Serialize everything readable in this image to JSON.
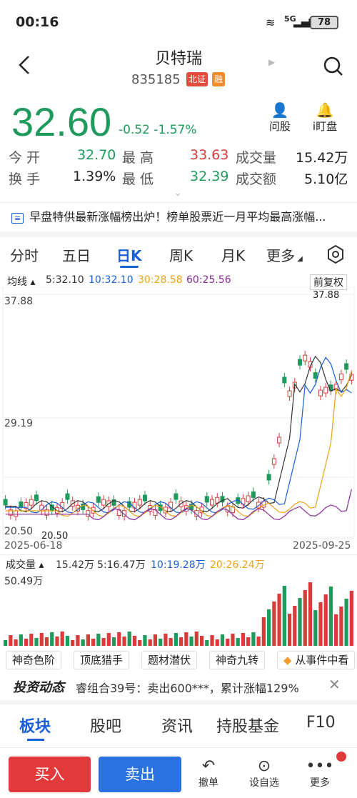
{
  "status": {
    "time": "00:16",
    "battery": "78",
    "network": "5G"
  },
  "header": {
    "title": "贝特瑞",
    "code": "835185",
    "tag_market": "北证",
    "tag_margin": "融",
    "ask_label": "问股",
    "watch_label": "i盯盘"
  },
  "quote": {
    "price": "32.60",
    "change": "-0.52",
    "change_pct": "-1.57%",
    "open_label": "今 开",
    "open": "32.70",
    "high_label": "最 高",
    "high": "33.63",
    "vol_label": "成交量",
    "vol": "15.42万",
    "turn_label": "换 手",
    "turn": "1.39%",
    "low_label": "最 低",
    "low": "32.39",
    "amt_label": "成交额",
    "amt": "5.10亿"
  },
  "news": "早盘特供最新涨幅榜出炉！榜单股票近一月平均最高涨幅...",
  "tabs": [
    "分时",
    "五日",
    "日K",
    "周K",
    "月K",
    "更多"
  ],
  "active_tab": "日K",
  "ma": {
    "label": "均线",
    "ma5": "5:32.10",
    "ma10": "10:32.10",
    "ma30": "30:28.58",
    "ma60": "60:25.56",
    "adj": "前复权"
  },
  "chart_data": {
    "type": "candlestick",
    "y_top": "37.88",
    "y_mid": "29.19",
    "y_low": "20.50",
    "max_label": "37.88",
    "min_label": "20.50",
    "start_date": "2025-06-18",
    "end_date": "2025-09-25"
  },
  "volume": {
    "label": "成交量",
    "v": "15.42万",
    "v5": "5:16.47万",
    "v10": "10:19.28万",
    "v20": "20:26.24万",
    "max": "50.49万"
  },
  "chips": [
    "神奇色阶",
    "顶底猎手",
    "题材潜伏",
    "神奇九转",
    "从事件中看"
  ],
  "invest": {
    "title": "投资动态",
    "text": "睿组合39号：卖出600***，累计涨幅129%"
  },
  "bottom_tabs": [
    "板块",
    "股吧",
    "资讯",
    "持股基金",
    "F10"
  ],
  "actions": {
    "buy": "买入",
    "sell": "卖出",
    "cancel": "撤单",
    "watch": "设自选",
    "more": "更多"
  },
  "colors": {
    "up": "#d93b3b",
    "down": "#1e9a5c",
    "accent": "#1a5fd8"
  }
}
